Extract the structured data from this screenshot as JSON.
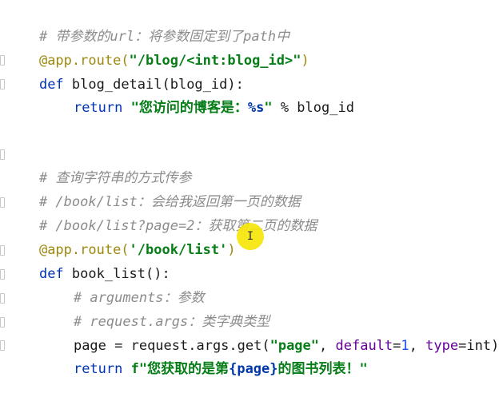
{
  "code": {
    "line1": {
      "comment": "# 带参数的url：将参数固定到了path中"
    },
    "line2": {
      "decorator": "@app.route(",
      "string": "\"/blog/<int:blog_id>\"",
      "close": ")"
    },
    "line3": {
      "kw": "def",
      "rest": " blog_detail(blog_id):"
    },
    "line4": {
      "kw": "return",
      "str_a": " \"您访问的博客是：",
      "fmt": "%s",
      "str_b": "\"",
      "rest": " % blog_id"
    },
    "line5": {
      "comment": "# 查询字符串的方式传参"
    },
    "line6": {
      "comment": "# /book/list：会给我返回第一页的数据"
    },
    "line7": {
      "comment": "# /book/list?page=2：获取第二页的数据"
    },
    "line8": {
      "decorator": "@app.route(",
      "string": "'/book/list'",
      "close": ")"
    },
    "line9": {
      "kw": "def",
      "rest": " book_list():"
    },
    "line10": {
      "comment": "# arguments：参数"
    },
    "line11": {
      "comment": "# request.args：类字典类型"
    },
    "line12": {
      "a": "page = request.args.get(",
      "string": "\"page\"",
      "b": ", ",
      "p1": "default",
      "c": "=",
      "num": "1",
      "d": ", ",
      "p2": "type",
      "e": "=int)"
    },
    "line13": {
      "kw": "return",
      "str_a": " f\"您获取的是第",
      "fmt": "{page}",
      "str_b": "的图书列表！\""
    }
  },
  "cursor": {
    "glyph": "I"
  }
}
